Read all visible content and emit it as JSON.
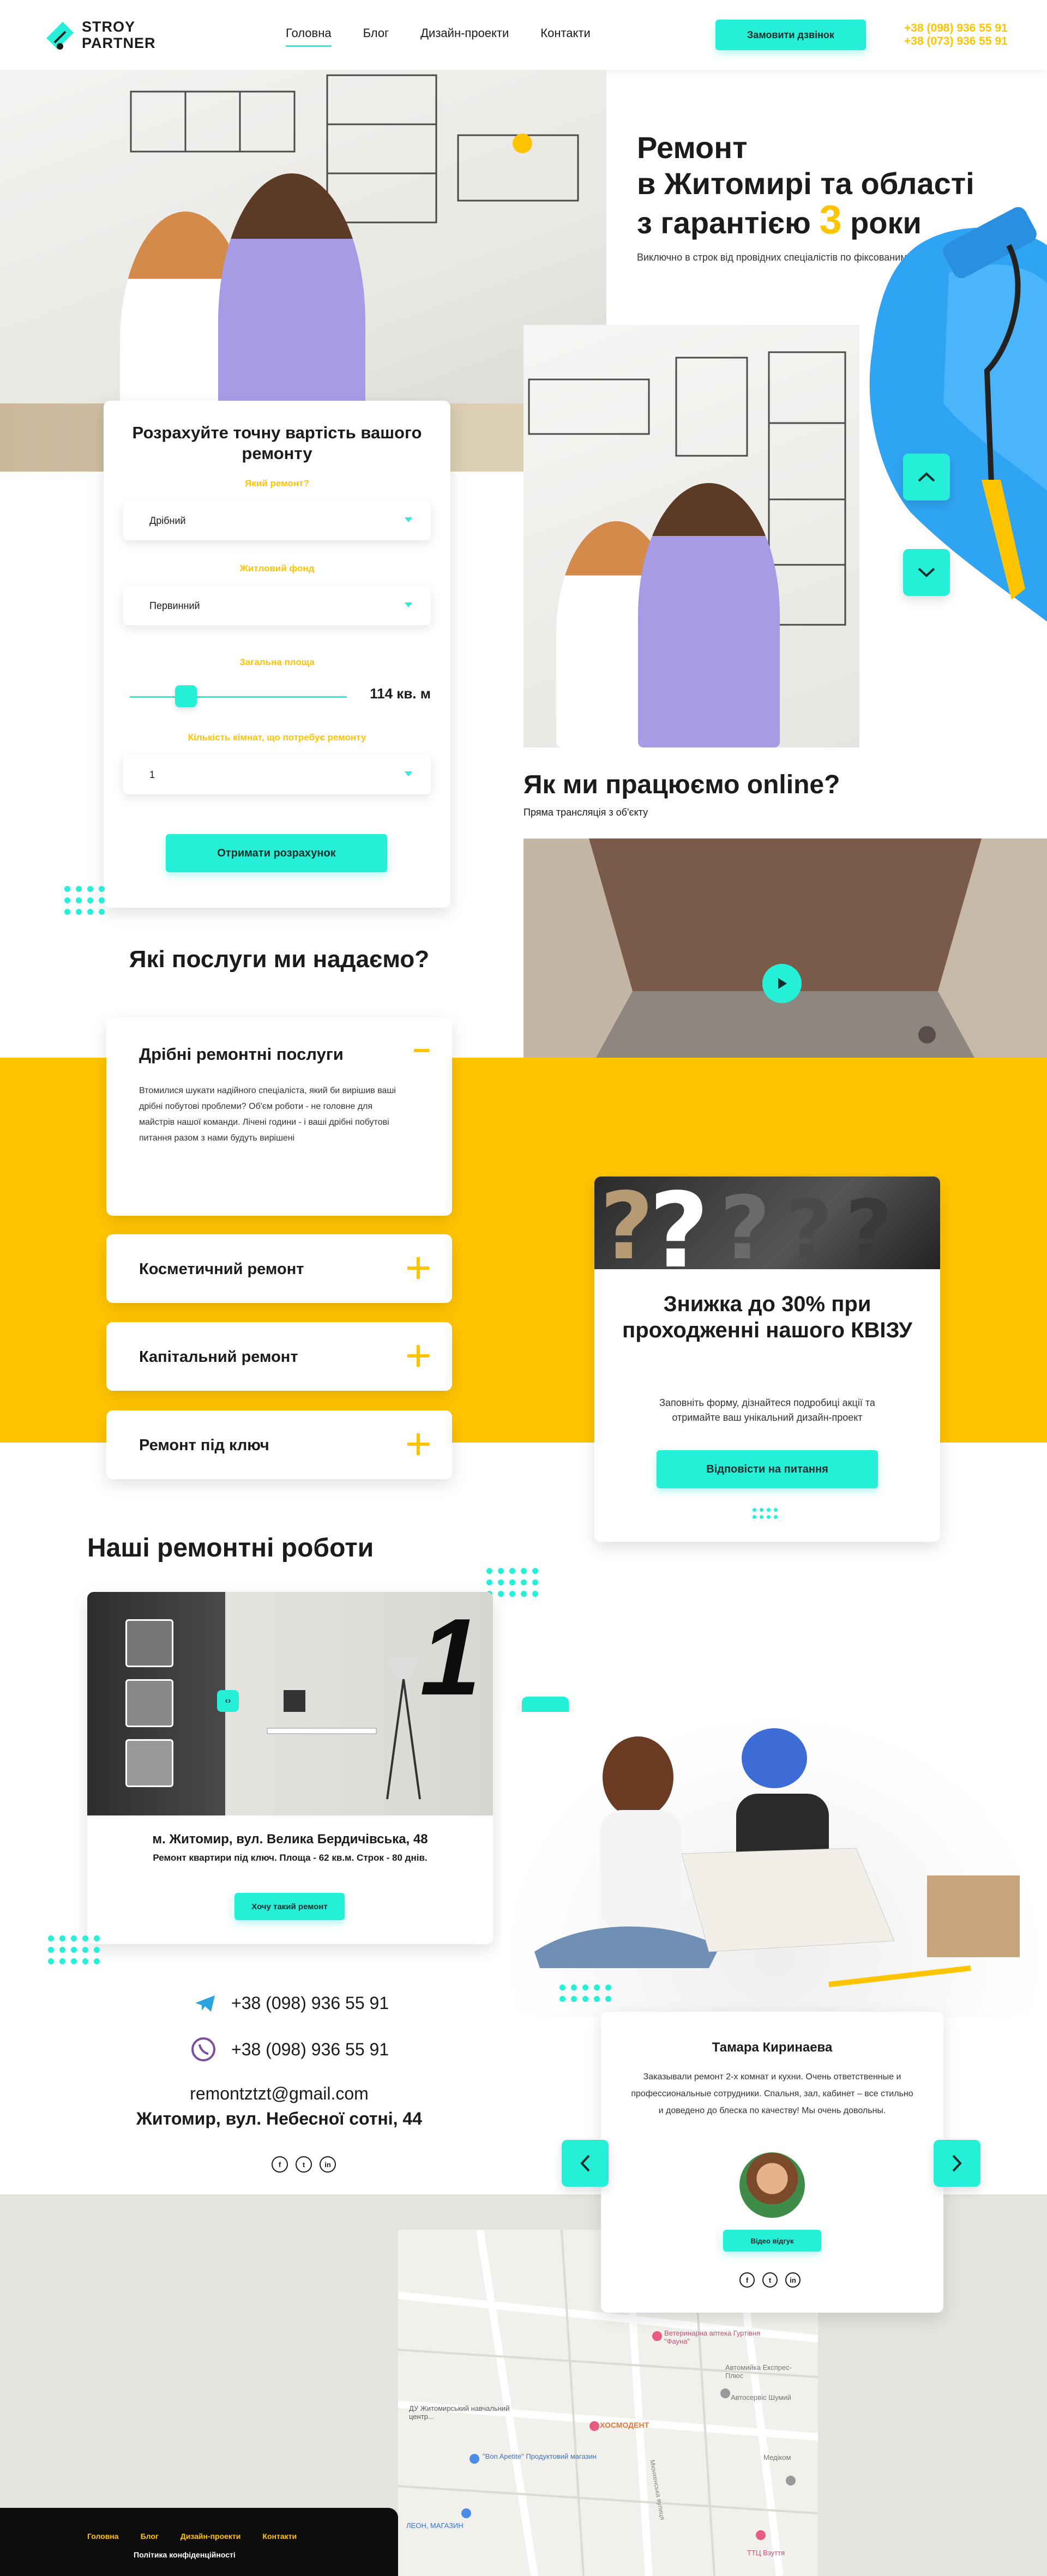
{
  "header": {
    "logo_line1": "STROY",
    "logo_line2": "PARTNER",
    "nav": [
      "Головна",
      "Блог",
      "Дизайн-проекти",
      "Контакти"
    ],
    "call_button": "Замовити дзвінок",
    "phone1": "+38 (098) 936 55 91",
    "phone2": "+38 (073) 936 55 91"
  },
  "hero": {
    "title_line1": "Ремонт",
    "title_line2": "в Житомирі та області",
    "title_line3_pre": "з гарантією",
    "title_years": "3",
    "title_line3_post": "роки",
    "subtitle": "Виключно в строк від провідних спеціалістів по фіксованим цінам"
  },
  "calculator": {
    "title": "Розрахуйте точну вартість вашого ремонту",
    "q1_label": "Який ремонт?",
    "q1_value": "Дрібний",
    "q2_label": "Житловий фонд",
    "q2_value": "Первинний",
    "q3_label": "Загальна площа",
    "area_value": "114 кв. м",
    "area_fraction": 0.26,
    "q4_label": "Кількість кімнат, що потребує ремонту",
    "q4_value": "1",
    "submit": "Отримати розрахунок"
  },
  "online": {
    "title": "Як ми працюємо online?",
    "subtitle": "Пряма трансляція з об'єкту"
  },
  "services": {
    "title": "Які послуги ми надаємо?",
    "open_title": "Дрібні ремонтні послуги",
    "open_text": "Втомилися шукати надійного спеціаліста, який би вирішив ваші дрібні побутові проблеми? Об'єм роботи - не головне для майстрів нашої команди. Лічені години - і ваші дрібні побутові питання разом з нами будуть вирішені",
    "items": [
      "Косметичний ремонт",
      "Капітальний ремонт",
      "Ремонт під ключ"
    ]
  },
  "quiz": {
    "title": "Знижка до 30% при проходженні нашого КВІЗУ",
    "text": "Заповніть форму, дізнайтеся подробиці акції та отримайте ваш унікальний дизайн-проект",
    "button": "Відповісти на питання"
  },
  "works": {
    "title": "Наші ремонтні роботи",
    "number": "1",
    "address": "м. Житомир, вул. Велика Бердичівська, 48",
    "description": "Ремонт квартири під ключ. Площа - 62 кв.м. Строк - 80 днів.",
    "button": "Хочу такий ремонт"
  },
  "contacts": {
    "telegram": "+38 (098) 936 55 91",
    "viber": "+38 (098) 936 55 91",
    "email": "remontztzt@gmail.com",
    "address": "Житомир, вул. Небесної сотні, 44",
    "social": [
      "f",
      "t",
      "in"
    ]
  },
  "review": {
    "name": "Тамара Киринаева",
    "text": "Заказывали ремонт 2-х комнат и кухни. Очень ответственные и профессиональные сотрудники. Спальня, зал, кабинет – все стильно и доведено до блеска по качеству! Мы очень довольны.",
    "video_button": "Відео відгук",
    "social": [
      "f",
      "t",
      "in"
    ]
  },
  "map": {
    "labels": [
      "Ветеринарна аптека Гуртівня \"Фауна\"",
      "ХОСМОДЕНТ",
      "ДУ Житомирський навчальний центр...",
      "\"Bon Apetite\" Продуктовий магазин",
      "ЛЕОН, МАГАЗИН",
      "ТТЦ Взуття",
      "Медіком",
      "Автомийка Експрес-Плюс",
      "Автосервіс Шумий",
      "Мюнхенська вулиця"
    ]
  },
  "footer": {
    "nav": [
      "Головна",
      "Блог",
      "Дизайн-проекти",
      "Контакти"
    ],
    "policy": "Політика конфіденційності"
  },
  "colors": {
    "accent": "#26efd8",
    "yellow": "#ffc400",
    "text": "#1b1b1b"
  }
}
